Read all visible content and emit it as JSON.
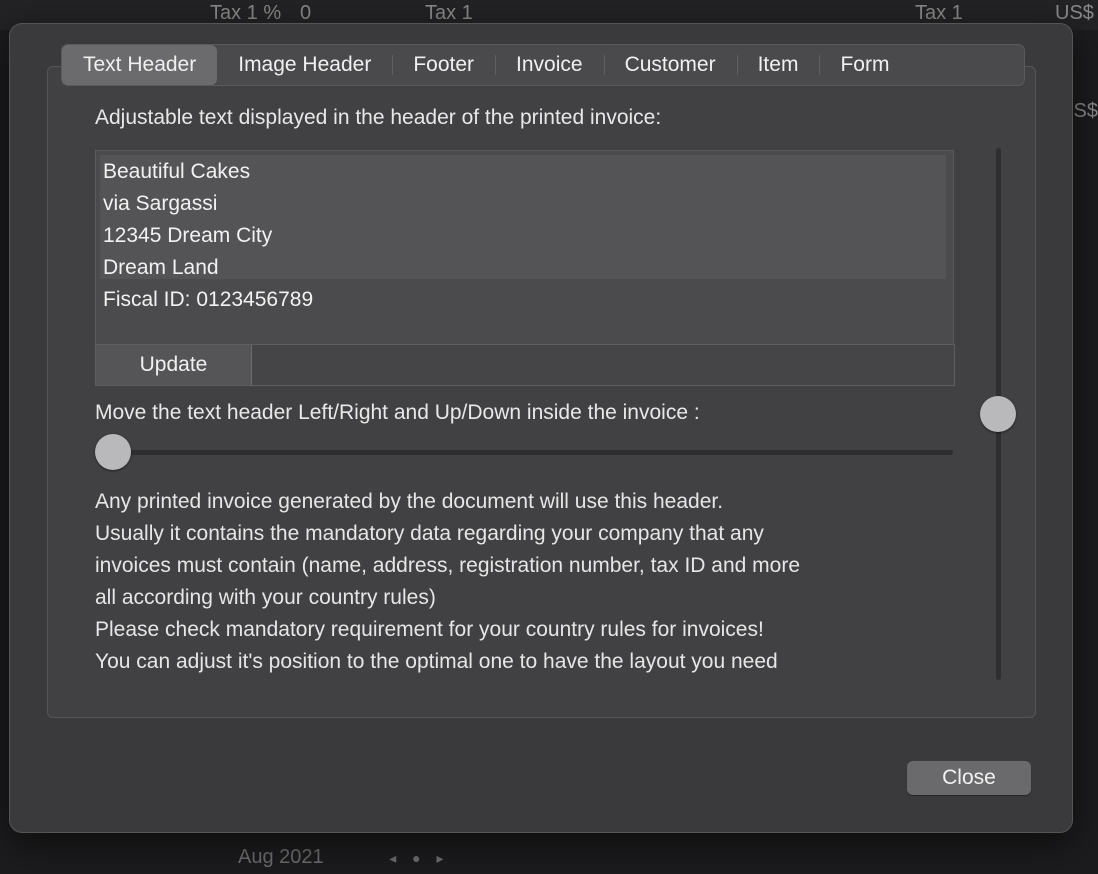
{
  "background": {
    "top": [
      "Tax 1 %",
      "0",
      "Tax 1",
      "Tax 1",
      "US$"
    ],
    "side": "S$",
    "bottom_date": "Aug 2021",
    "bottom_nav": "◂ ● ▸"
  },
  "tabs": [
    {
      "label": "Text Header",
      "active": true
    },
    {
      "label": "Image Header",
      "active": false
    },
    {
      "label": "Footer",
      "active": false
    },
    {
      "label": "Invoice",
      "active": false
    },
    {
      "label": "Customer",
      "active": false
    },
    {
      "label": "Item",
      "active": false
    },
    {
      "label": "Form",
      "active": false
    }
  ],
  "header_label": "Adjustable text displayed in the header of the printed invoice:",
  "header_text_lines": [
    "Beautiful Cakes",
    "via Sargassi",
    "12345 Dream City",
    "Dream Land",
    "Fiscal ID: 0123456789"
  ],
  "update_button": "Update",
  "move_label": "Move the text header Left/Right and Up/Down inside the invoice :",
  "horizontal_position": 0.0,
  "vertical_position": 0.5,
  "info_lines": [
    "Any printed invoice generated by  the document will use this header.",
    "Usually it contains the mandatory data regarding your company that any",
    "invoices must contain (name, address, registration number, tax ID and more",
    "all according with your country rules)",
    "Please check mandatory requirement for your country rules for invoices!",
    "You can adjust it's position to the optimal one to have the layout you need"
  ],
  "close_button": "Close"
}
